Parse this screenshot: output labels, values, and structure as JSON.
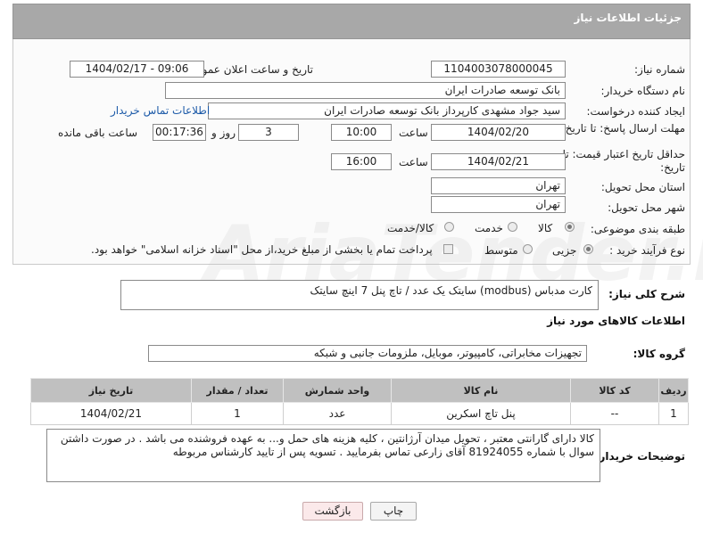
{
  "header": {
    "title": "جزئیات اطلاعات نیاز"
  },
  "form": {
    "need_number_label": "شماره نیاز:",
    "need_number": "1104003078000045",
    "announce_label": "تاریخ و ساعت اعلان عمومی:",
    "announce_value": "1404/02/17 - 09:06",
    "buyer_org_label": "نام دستگاه خریدار:",
    "buyer_org": "بانک توسعه صادرات ایران",
    "creator_label": "ایجاد کننده درخواست:",
    "creator": "سید جواد مشهدی کارپرداز بانک توسعه صادرات ایران",
    "contact_link": "اطلاعات تماس خریدار",
    "deadline_label": "مهلت ارسال پاسخ: تا تاریخ:",
    "deadline_date": "1404/02/20",
    "time_label": "ساعت",
    "deadline_time": "10:00",
    "days_value": "3",
    "days_label": "روز و",
    "remaining_value": "00:17:36",
    "remaining_label": "ساعت باقی مانده",
    "validity_label": "حداقل تاریخ اعتبار قیمت: تا تاریخ:",
    "validity_date": "1404/02/21",
    "validity_time": "16:00",
    "province_label": "استان محل تحویل:",
    "province": "تهران",
    "city_label": "شهر محل تحویل:",
    "city": "تهران",
    "category_label": "طبقه بندی موضوعی:",
    "category_options": [
      "کالا",
      "خدمت",
      "کالا/خدمت"
    ],
    "process_label": "نوع فرآیند خرید :",
    "process_options": [
      "جزیی",
      "متوسط"
    ],
    "payment_note": "پرداخت تمام یا بخشی از مبلغ خرید،از محل \"اسناد خزانه اسلامی\" خواهد بود."
  },
  "watermark": "AriaTender.net",
  "description": {
    "label": "شرح کلی نیاز:",
    "text": "کارت مدباس (modbus) سایتک یک عدد / تاچ پنل 7 اینچ سایتک"
  },
  "goods_section": {
    "title": "اطلاعات کالاهای مورد نیاز"
  },
  "goods_group": {
    "label": "گروه کالا:",
    "value": "تجهیزات مخابراتی، کامپیوتر، موبایل، ملزومات جانبی و شبکه"
  },
  "table": {
    "headers": [
      "ردیف",
      "کد کالا",
      "نام کالا",
      "واحد شمارش",
      "تعداد / مقدار",
      "تاریخ نیاز"
    ],
    "rows": [
      [
        "1",
        "--",
        "پنل تاچ اسکرین",
        "عدد",
        "1",
        "1404/02/21"
      ]
    ]
  },
  "buyer_notes": {
    "label": "توضیحات خریدار:",
    "lines": [
      "کالا دارای گارانتی معتبر ، تحویل میدان آرژانتین ، کلیه هزینه های حمل و... به عهده فروشنده می باشد . در صورت داشتن",
      "سوال با شماره 81924055 آقای زارعی تماس بفرمایید . تسویه پس از تایید کارشناس مربوطه"
    ]
  },
  "buttons": {
    "print": "چاپ",
    "back": "بازگشت"
  }
}
